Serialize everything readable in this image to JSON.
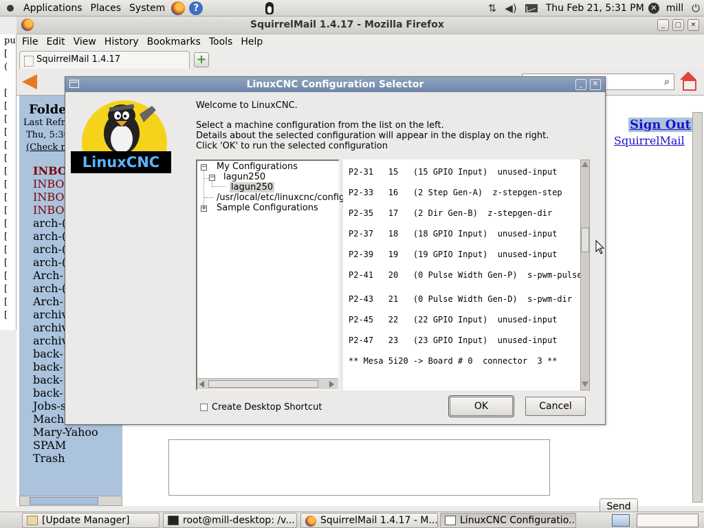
{
  "top_panel": {
    "menus": [
      "Applications",
      "Places",
      "System"
    ],
    "datetime": "Thu Feb 21,  5:31 PM",
    "user": "mill"
  },
  "firefox": {
    "title": "SquirrelMail 1.4.17 - Mozilla Firefox",
    "title_ghost": "root@mill-desktop: /",
    "menu": [
      "File",
      "Edit",
      "View",
      "History",
      "Bookmarks",
      "Tools",
      "Help"
    ],
    "tab_label": "SquirrelMail 1.4.17",
    "new_tab": "+"
  },
  "left_strip": {
    "lines": [
      "pu",
      "[",
      "  (",
      "",
      "[",
      "[",
      "[",
      "[",
      "[",
      "[",
      "[",
      "[",
      "[",
      "[",
      "[",
      "[",
      "[",
      "[",
      "[",
      "[",
      "[",
      "["
    ]
  },
  "squirrelmail": {
    "folders_title": "Folde",
    "last_refresh": "Last Refr",
    "refresh_time": "Thu, 5:30",
    "check_mail": "(Check m",
    "folders": [
      {
        "name": "INBO",
        "unread": true,
        "bold": true
      },
      {
        "name": "INBO",
        "unread": true
      },
      {
        "name": "INBO",
        "unread": true
      },
      {
        "name": "INBO",
        "unread": true
      },
      {
        "name": "arch-("
      },
      {
        "name": "arch-("
      },
      {
        "name": "arch-("
      },
      {
        "name": "arch-("
      },
      {
        "name": "Arch-"
      },
      {
        "name": "arch-("
      },
      {
        "name": "Arch-"
      },
      {
        "name": "archiv"
      },
      {
        "name": "archiv"
      },
      {
        "name": "archiv"
      },
      {
        "name": "back-"
      },
      {
        "name": "back-"
      },
      {
        "name": "back-"
      },
      {
        "name": "back-"
      },
      {
        "name": "Jobs-s"
      },
      {
        "name": "Mach"
      },
      {
        "name": "Mary-Yahoo"
      },
      {
        "name": "SPAM"
      },
      {
        "name": "Trash"
      }
    ],
    "sign_out": "Sign Out",
    "squirrelmail_link": "SquirrelMail",
    "send": "Send"
  },
  "taskbar": {
    "tasks": [
      {
        "label": "[Update Manager]",
        "active": false
      },
      {
        "label": "root@mill-desktop: /v...",
        "active": false
      },
      {
        "label": "SquirrelMail 1.4.17 - M...",
        "active": false
      },
      {
        "label": "LinuxCNC Configuratio...",
        "active": true
      }
    ]
  },
  "dialog": {
    "title": "LinuxCNC Configuration Selector",
    "logo_text": "LinuxCNC",
    "welcome": "Welcome to LinuxCNC.",
    "instructions": [
      "Select a machine configuration from the list on the left.",
      "Details about the selected configuration will appear in the display on the right.",
      "Click 'OK' to run the selected configuration"
    ],
    "tree": {
      "my_configurations": "My Configurations",
      "lagun250_folder": "lagun250",
      "lagun250_selected": "lagun250",
      "system_path": "/usr/local/etc/linuxcnc/config",
      "sample_configurations": "Sample Configurations"
    },
    "details_lines": [
      "P2-31   15   (15 GPIO Input)  unused-input",
      "P2-33   16   (2 Step Gen-A)  z-stepgen-step",
      "P2-35   17   (2 Dir Gen-B)  z-stepgen-dir",
      "P2-37   18   (18 GPIO Input)  unused-input",
      "P2-39   19   (19 GPIO Input)  unused-input",
      "P2-41   20   (0 Pulse Width Gen-P)  s-pwm-pulse",
      "P2-43   21   (0 Pulse Width Gen-D)  s-pwm-dir",
      "P2-45   22   (22 GPIO Input)  unused-input",
      "P2-47   23   (23 GPIO Input)  unused-input",
      "** Mesa 5i20 -> Board # 0  connector  3 **"
    ],
    "create_shortcut": "Create Desktop Shortcut",
    "ok": "OK",
    "cancel": "Cancel"
  }
}
